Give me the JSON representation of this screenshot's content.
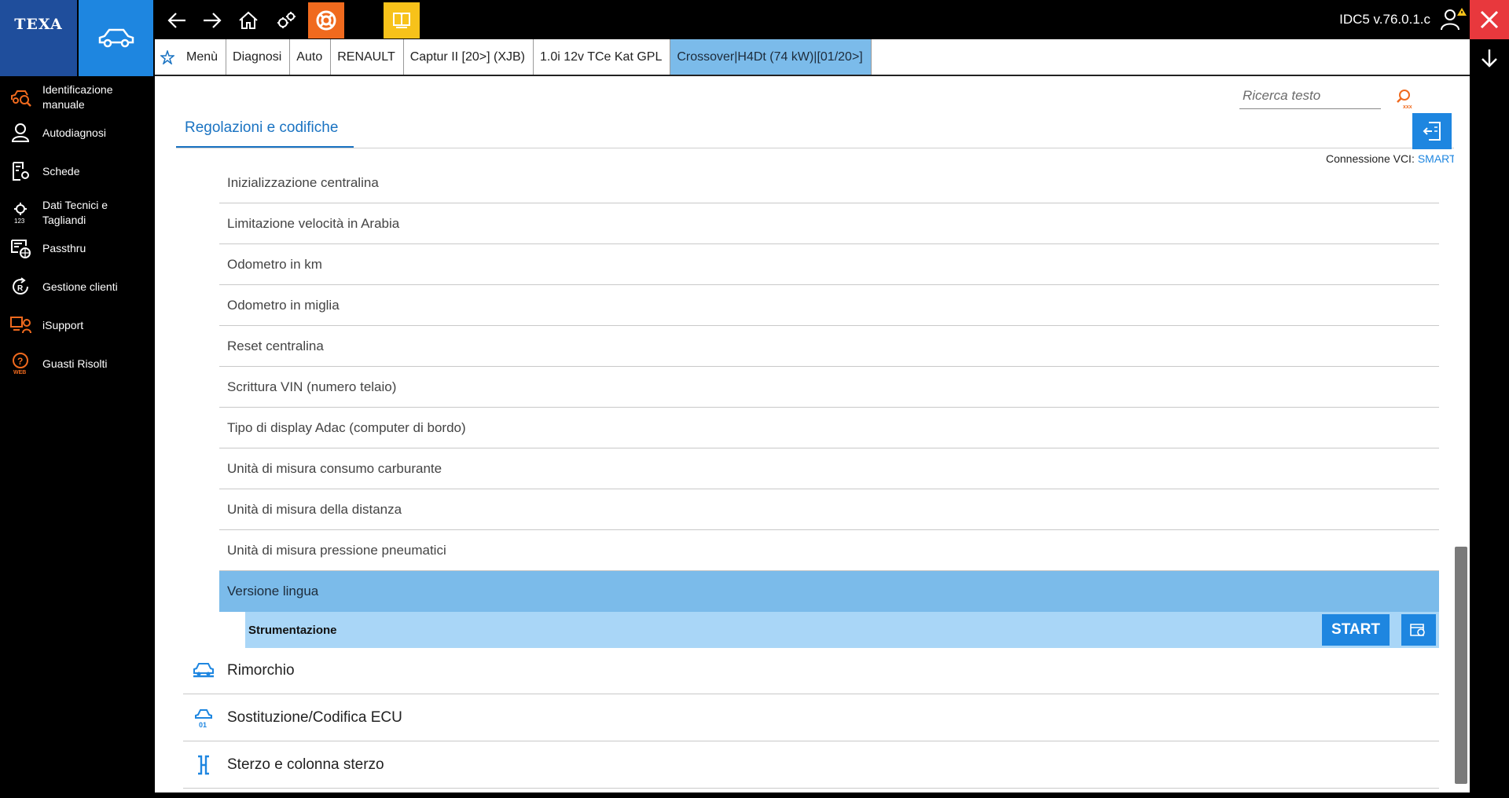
{
  "app": {
    "logo": "TEXA",
    "version": "IDC5 v.76.0.1.c"
  },
  "breadcrumb": [
    {
      "label": "Menù"
    },
    {
      "label": "Diagnosi"
    },
    {
      "label": "Auto"
    },
    {
      "label": "RENAULT"
    },
    {
      "label": "Captur II [20>] (XJB)"
    },
    {
      "label": "1.0i 12v TCe Kat GPL"
    },
    {
      "label": "Crossover|H4Dt (74 kW)|[01/20>]"
    }
  ],
  "sidebar": {
    "items": [
      {
        "label": "Identificazione manuale",
        "icon": "car-search-icon"
      },
      {
        "label": "Autodiagnosi",
        "icon": "person-icon"
      },
      {
        "label": "Schede",
        "icon": "document-gear-icon"
      },
      {
        "label": "Dati Tecnici e Tagliandi",
        "icon": "gear-123-icon"
      },
      {
        "label": "Passthru",
        "icon": "passthru-globe-icon"
      },
      {
        "label": "Gestione clienti",
        "icon": "customer-cycle-icon"
      },
      {
        "label": "iSupport",
        "icon": "support-icon"
      },
      {
        "label": "Guasti Risolti",
        "icon": "web-question-icon"
      }
    ]
  },
  "search": {
    "placeholder": "Ricerca testo"
  },
  "tab": {
    "label": "Regolazioni e codifiche"
  },
  "vci": {
    "label": "Connessione VCI:",
    "value": "SMART"
  },
  "list": {
    "items": [
      {
        "label": "Inizializzazione centralina"
      },
      {
        "label": "Limitazione velocità in Arabia"
      },
      {
        "label": "Odometro in km"
      },
      {
        "label": "Odometro in miglia"
      },
      {
        "label": "Reset centralina"
      },
      {
        "label": "Scrittura VIN (numero telaio)"
      },
      {
        "label": "Tipo di display Adac (computer di bordo)"
      },
      {
        "label": "Unità di misura consumo carburante"
      },
      {
        "label": "Unità di misura della distanza"
      },
      {
        "label": "Unità di misura pressione pneumatici"
      }
    ],
    "selected": {
      "label": "Versione lingua"
    },
    "sub": {
      "label": "Strumentazione",
      "start": "START"
    }
  },
  "categories": [
    {
      "label": "Rimorchio",
      "icon": "trailer-icon"
    },
    {
      "label": "Sostituzione/Codifica ECU",
      "icon": "ecu-replace-icon"
    },
    {
      "label": "Sterzo e colonna sterzo",
      "icon": "steering-icon"
    }
  ],
  "colors": {
    "accent": "#1e86e0",
    "selected_row": "#7bbbea",
    "sub_row": "#a9d6f7",
    "orange": "#f06a1e",
    "yellow": "#f7c21a",
    "close": "#e8383d"
  }
}
